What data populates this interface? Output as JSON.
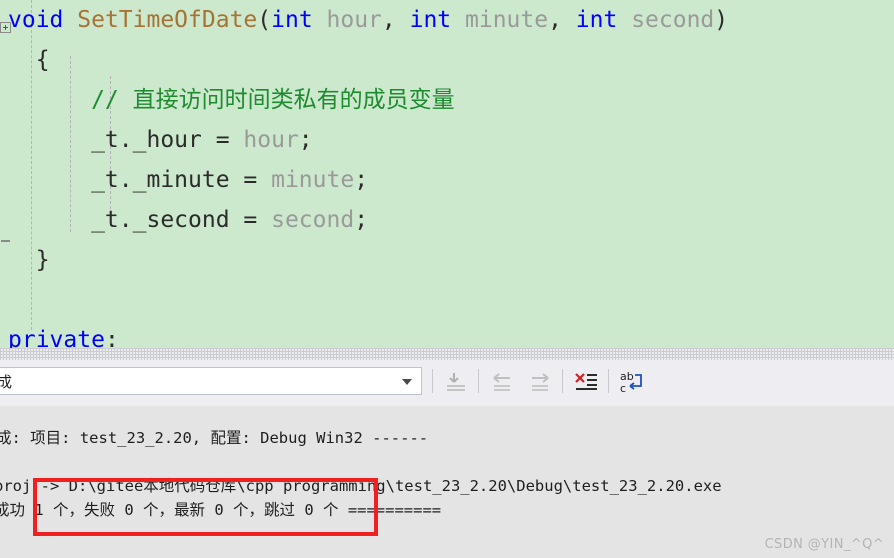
{
  "editor": {
    "background_color": "#cce8cd",
    "fold_icon": "collapse-box-icon",
    "lines": [
      {
        "id": "signature",
        "tokens": [
          {
            "text": "void ",
            "cls": "kw"
          },
          {
            "text": "SetTimeOfDate",
            "cls": "fn"
          },
          {
            "text": "(",
            "cls": "punc"
          },
          {
            "text": "int ",
            "cls": "kw"
          },
          {
            "text": "hour",
            "cls": "ident"
          },
          {
            "text": ", ",
            "cls": "punc"
          },
          {
            "text": "int ",
            "cls": "kw"
          },
          {
            "text": "minute",
            "cls": "ident"
          },
          {
            "text": ", ",
            "cls": "punc"
          },
          {
            "text": "int ",
            "cls": "kw"
          },
          {
            "text": "second",
            "cls": "ident"
          },
          {
            "text": ")",
            "cls": "punc"
          }
        ]
      },
      {
        "id": "open-brace",
        "tokens": [
          {
            "text": "  {",
            "cls": "plain"
          }
        ]
      },
      {
        "id": "comment",
        "tokens": [
          {
            "text": "      // 直接访问时间类私有的成员变量",
            "cls": "comment"
          }
        ]
      },
      {
        "id": "assign-hour",
        "tokens": [
          {
            "text": "      _t._hour = ",
            "cls": "plain"
          },
          {
            "text": "hour",
            "cls": "ident"
          },
          {
            "text": ";",
            "cls": "plain"
          }
        ]
      },
      {
        "id": "assign-minute",
        "tokens": [
          {
            "text": "      _t._minute = ",
            "cls": "plain"
          },
          {
            "text": "minute",
            "cls": "ident"
          },
          {
            "text": ";",
            "cls": "plain"
          }
        ]
      },
      {
        "id": "assign-second",
        "tokens": [
          {
            "text": "      _t._second = ",
            "cls": "plain"
          },
          {
            "text": "second",
            "cls": "ident"
          },
          {
            "text": ";",
            "cls": "plain"
          }
        ]
      },
      {
        "id": "close-brace",
        "tokens": [
          {
            "text": "  }",
            "cls": "plain"
          }
        ]
      },
      {
        "id": "blank",
        "tokens": [
          {
            "text": " ",
            "cls": "plain"
          }
        ]
      },
      {
        "id": "access-specifier",
        "tokens": [
          {
            "text": "private",
            "cls": "kw"
          },
          {
            "text": ":",
            "cls": "plain"
          }
        ]
      }
    ]
  },
  "output_panel": {
    "background_color": "#e4e4e4",
    "toolbar": {
      "source_combo": {
        "value": "成",
        "arrow_icon": "chevron-down-icon"
      },
      "buttons": [
        {
          "name": "go-to-message-button",
          "icon": "go-to-arrow-icon",
          "enabled": false
        },
        {
          "name": "previous-message-button",
          "icon": "arrow-left-icon",
          "enabled": false
        },
        {
          "name": "next-message-button",
          "icon": "arrow-right-icon",
          "enabled": false
        },
        {
          "name": "clear-all-button",
          "icon": "clear-all-icon",
          "enabled": true
        },
        {
          "name": "toggle-word-wrap-button",
          "icon": "word-wrap-icon",
          "enabled": true
        }
      ]
    },
    "lines": [
      "成: 项目: test_23_2.20, 配置: Debug Win32 ------",
      "proj -> D:\\gitee本地代码仓库\\cpp programming\\test_23_2.20\\Debug\\test_23_2.20.exe",
      "成功 1 个，失败 0 个，最新 0 个，跳过 0 个 =========="
    ]
  },
  "annotation": {
    "color": "#f02020",
    "shape": "rectangle",
    "target_line": "成功 1 个，失败 0 个，最新 0 个，跳过 0 个"
  },
  "watermark": {
    "text": "CSDN @YIN_^Q^"
  }
}
